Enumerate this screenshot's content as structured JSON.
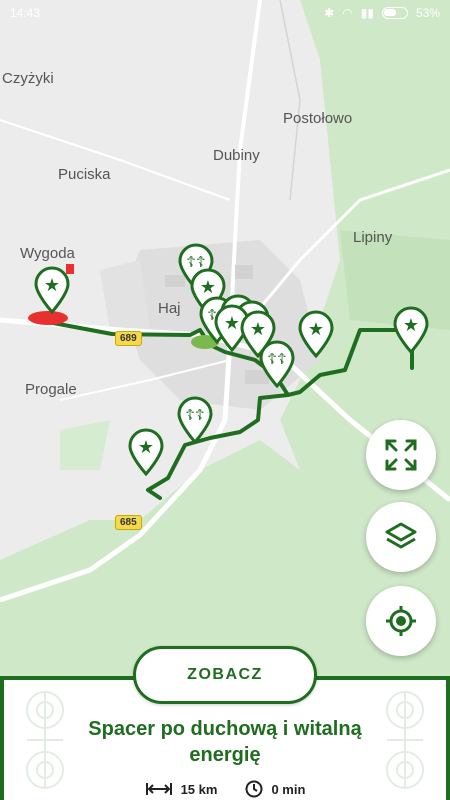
{
  "status_bar": {
    "time": "14:43",
    "battery": "53%"
  },
  "map": {
    "places": [
      {
        "id": "czyzyki",
        "name": "Czyżyki"
      },
      {
        "id": "postolowo",
        "name": "Postołowo"
      },
      {
        "id": "dubiny",
        "name": "Dubiny"
      },
      {
        "id": "puciska",
        "name": "Puciska"
      },
      {
        "id": "lipiny",
        "name": "Lipiny"
      },
      {
        "id": "wygoda",
        "name": "Wygoda"
      },
      {
        "id": "hajnowka",
        "name": "Haj"
      },
      {
        "id": "progale",
        "name": "Progale"
      }
    ],
    "roads": [
      {
        "id": "r689",
        "number": "689"
      },
      {
        "id": "r685",
        "number": "685"
      }
    ],
    "pins": [
      {
        "type": "star"
      },
      {
        "type": "cross"
      },
      {
        "type": "star"
      },
      {
        "type": "cross"
      },
      {
        "type": "star"
      },
      {
        "type": "star"
      },
      {
        "type": "star"
      },
      {
        "type": "cross"
      },
      {
        "type": "star"
      },
      {
        "type": "star"
      },
      {
        "type": "cross"
      },
      {
        "type": "star"
      }
    ]
  },
  "controls": {
    "fullscreen": "expand-icon",
    "layers": "layers-icon",
    "locate": "locate-icon"
  },
  "route": {
    "button_label": "ZOBACZ",
    "title": "Spacer po duchową i witalną energię",
    "distance": "15 km",
    "duration": "0 min"
  },
  "colors": {
    "accent": "#1f6d1f",
    "forest": "#cfe8c8",
    "town": "#dedede",
    "marker_red": "#e8312f"
  }
}
